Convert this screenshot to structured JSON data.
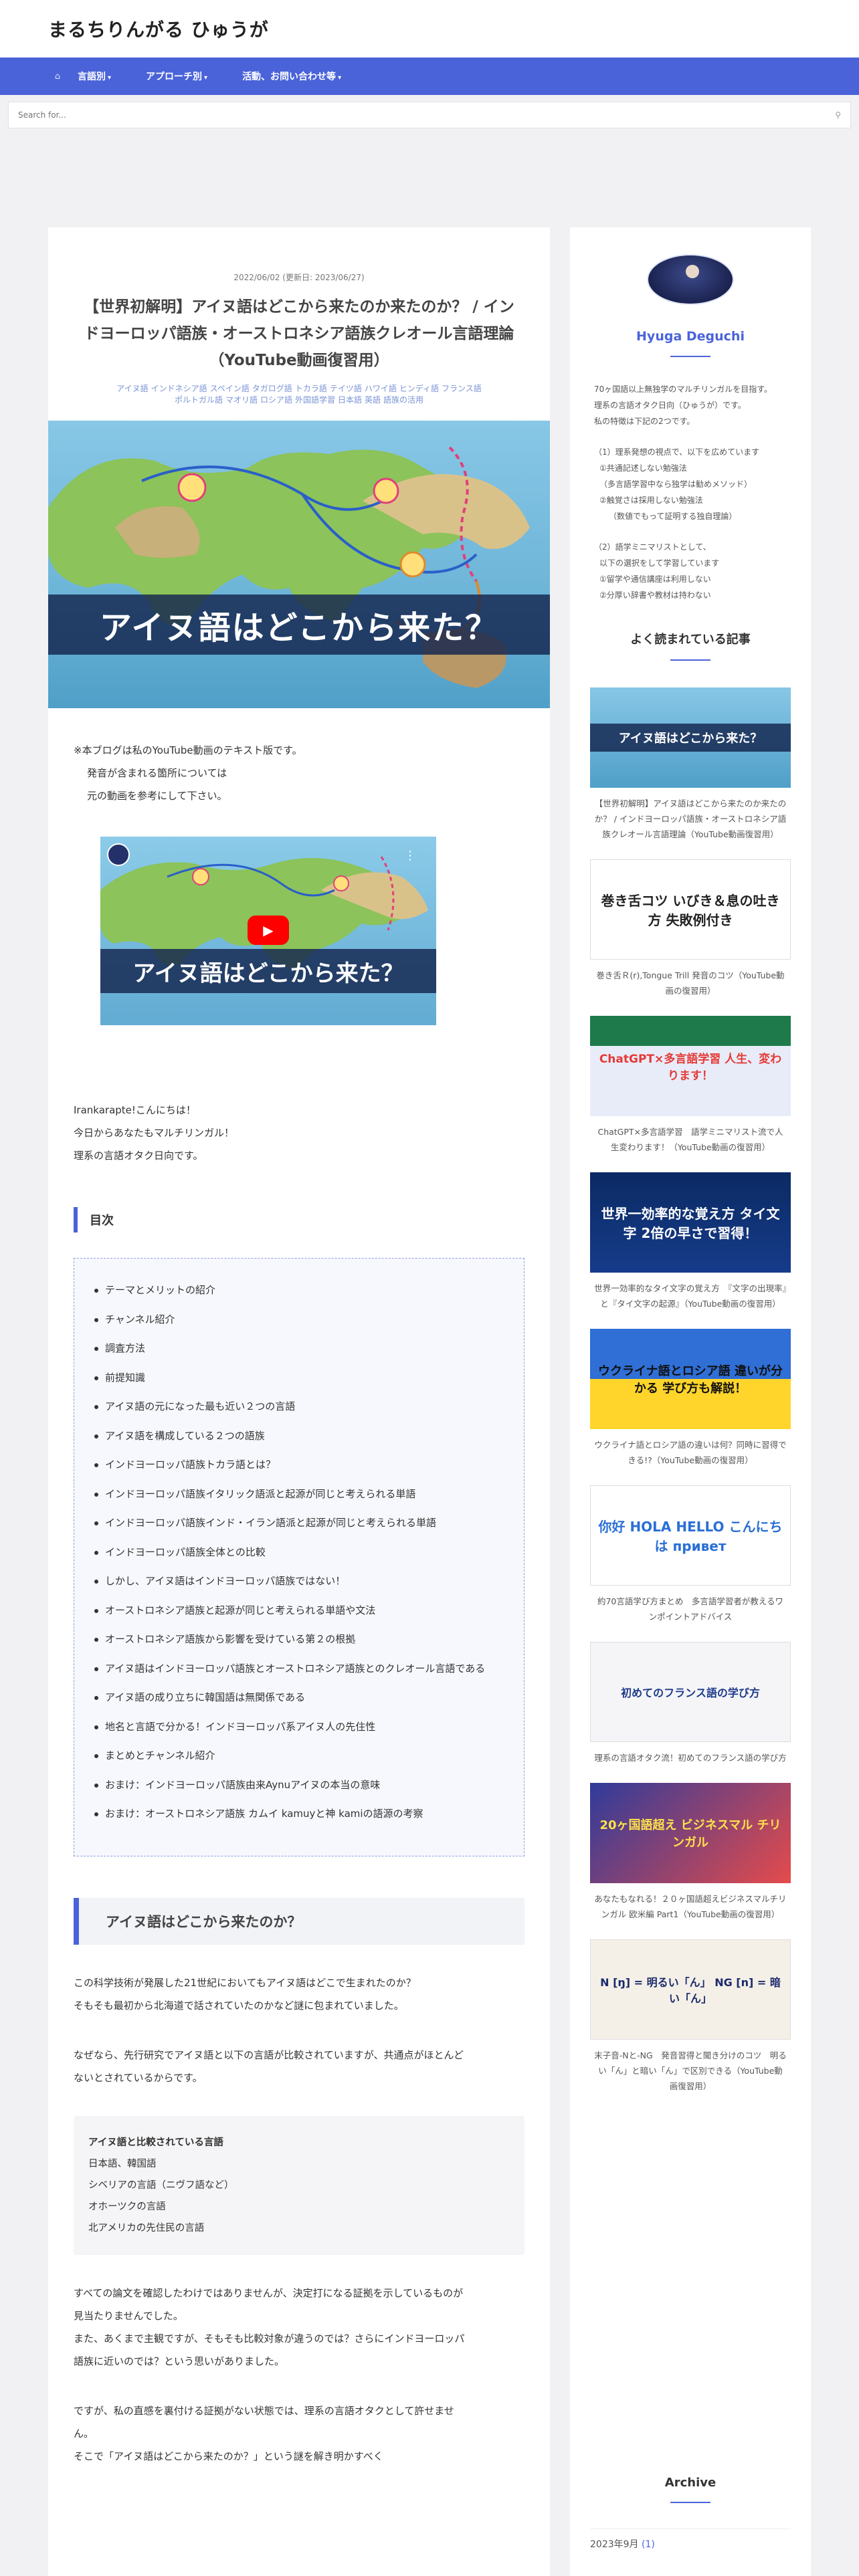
{
  "site": {
    "title": "まるちりんがる ひゅうが"
  },
  "nav": {
    "home_icon": "home-icon",
    "items": [
      {
        "label": "言語別"
      },
      {
        "label": "アプローチ別"
      },
      {
        "label": "活動、お問い合わせ等"
      }
    ]
  },
  "search": {
    "placeholder": "Search for..."
  },
  "post": {
    "date": "2022/06/02 (更新日: 2023/06/27)",
    "title": "【世界初解明】アイヌ語はどこから来たのか来たのか？ / インドヨーロッパ語族・オーストロネシア語族クレオール言語理論（YouTube動画復習用）",
    "tags": [
      "アイヌ語",
      "インドネシア語",
      "スペイン語",
      "タガログ語",
      "トカラ語",
      "テイツ語",
      "ハワイ語",
      "ヒンディ語",
      "フランス語",
      "ポルトガル語",
      "マオリ語",
      "ロシア語",
      "外国語学習",
      "日本語",
      "英語",
      "語族の活用"
    ],
    "hero_caption": "アイヌ語はどこから来た？",
    "intro": {
      "line1": "※本ブログは私のYouTube動画のテキスト版です。",
      "line2": "発音が含まれる箇所については",
      "line3": "元の動画を参考にして下さい。"
    },
    "video_caption": "アイヌ語はどこから来た？",
    "greeting": {
      "line1": "Irankarapte!こんにちは！",
      "line2": "今日からあなたもマルチリンガル！",
      "line3": "理系の言語オタク日向です。"
    },
    "toc_title": "目次",
    "toc": [
      "テーマとメリットの紹介",
      "チャンネル紹介",
      "調査方法",
      "前提知識",
      "アイヌ語の元になった最も近い２つの言語",
      "アイヌ語を構成している２つの語族",
      "インドヨーロッパ語族トカラ語とは？",
      "インドヨーロッパ語族イタリック語派と起源が同じと考えられる単語",
      "インドヨーロッパ語族インド・イラン語派と起源が同じと考えられる単語",
      "インドヨーロッパ語族全体との比較",
      "しかし、アイヌ語はインドヨーロッパ語族ではない！",
      "オーストロネシア語族と起源が同じと考えられる単語や文法",
      "オーストロネシア語族から影響を受けている第２の根拠",
      "アイヌ語はインドヨーロッパ語族とオーストロネシア語族とのクレオール言語である",
      "アイヌ語の成り立ちに韓国語は無関係である",
      "地名と言語で分かる！インドヨーロッパ系アイヌ人の先住性",
      "まとめとチャンネル紹介",
      "おまけ：インドヨーロッパ語族由来Aynuアイヌの本当の意味",
      "おまけ：オーストロネシア語族 カムイ kamuyと神 kamiの語源の考察"
    ],
    "h2": "アイヌ語はどこから来たのか？",
    "p1": {
      "line1": "この科学技術が発展した21世紀においてもアイヌ語はどこで生まれたのか？",
      "line2": "そもそも最初から北海道で話されていたのかなど謎に包まれていました。"
    },
    "p2": {
      "line1": "なぜなら、先行研究でアイヌ語と以下の言語が比較されていますが、共通点がほとんど",
      "line2": "ないとされているからです。"
    },
    "box": {
      "title": "アイヌ語と比較されている言語",
      "items": [
        "日本語、韓国語",
        "シベリアの言語（ニヴフ語など）",
        "オホーツクの言語",
        "北アメリカの先住民の言語"
      ]
    },
    "p3": {
      "line1": "すべての論文を確認したわけではありませんが、決定打になる証拠を示しているものが",
      "line2": "見当たりませんでした。",
      "line3": "また、あくまで主観ですが、そもそも比較対象が違うのでは？さらにインドヨーロッパ",
      "line4": "語族に近いのでは？という思いがありました。"
    },
    "p4": {
      "line1": "ですが、私の直感を裏付ける証拠がない状態では、理系の言語オタクとして許せませ",
      "line2": "ん。",
      "line3": "そこで「アイヌ語はどこから来たのか？」という謎を解き明かすべく"
    }
  },
  "sidebar": {
    "profile_name": "Hyuga Deguchi",
    "profile": {
      "l1": "70ヶ国語以上無独学のマルチリンガルを目指す。",
      "l2": "理系の言語オタク日向（ひゅうが）です。",
      "l3": "私の特徴は下記の2つです。",
      "l4": "（1）理系発想の視点で、以下を広めています",
      "l5": "①共通記述しない勉強法",
      "l6": "（多言語学習中なら独学は勧めメソッド）",
      "l7": "②触覚さは採用しない勉強法",
      "l8": "（数値でもって証明する独自理論）",
      "l9": "（2）語学ミニマリストとして、",
      "l10": "以下の選択をして学習しています",
      "l11": "①留学や通信講座は利用しない",
      "l12": "②分厚い辞書や教材は持わない"
    },
    "popular_title": "よく読まれている記事",
    "popular": [
      {
        "thumb": "アイヌ語はどこから来た？",
        "caption": "【世界初解明】アイヌ語はどこから来たのか来たのか？ / インドヨーロッパ語族・オーストロネシア語族クレオール言語理論（YouTube動画復習用）"
      },
      {
        "thumb": "巻き舌コツ いびき＆息の吐き方 失敗例付き",
        "caption": "巻き舌Ｒ(r),Tongue Trill 発音のコツ（YouTube動画の復習用）"
      },
      {
        "thumb": "ChatGPT×多言語学習 人生、変わります！",
        "caption": "ChatGPT×多言語学習　語学ミニマリスト流で人生変わります！（YouTube動画の復習用）"
      },
      {
        "thumb": "世界一効率的な覚え方 タイ文字 2倍の早さで習得！",
        "caption": "世界一効率的なタイ文字の覚え方　『文字の出現率』と『タイ文字の起源』（YouTube動画の復習用）"
      },
      {
        "thumb": "ウクライナ語とロシア語 違いが分かる 学び方も解説！",
        "caption": "ウクライナ語とロシア語の違いは何？同時に習得できる!?（YouTube動画の復習用）"
      },
      {
        "thumb": "你好 HOLA HELLO こんにちは привет",
        "caption": "約70言語学び方まとめ　多言語学習者が教えるワンポイントアドバイス"
      },
      {
        "thumb": "初めてのフランス語の学び方",
        "caption": "理系の言語オタク流！初めてのフランス語の学び方"
      },
      {
        "thumb": "20ヶ国語超え ビジネスマル チリンガル",
        "caption": "あなたもなれる！２０ヶ国語超えビジネスマルチリンガル 欧米編 Part1（YouTube動画の復習用）"
      },
      {
        "thumb": "N [ŋ] = 明るい「ん」 NG [n] = 暗い「ん」",
        "caption": "末子音-Nと-NG　発音習得と聞き分けのコツ　明るい「ん」と暗い「ん」で区別できる（YouTube動画復習用）"
      }
    ],
    "archive_title": "Archive",
    "archive_row": {
      "month": "2023年9月",
      "count": "(1)"
    }
  },
  "colors": {
    "accent": "#4a63d9",
    "link": "#7a93d6"
  }
}
